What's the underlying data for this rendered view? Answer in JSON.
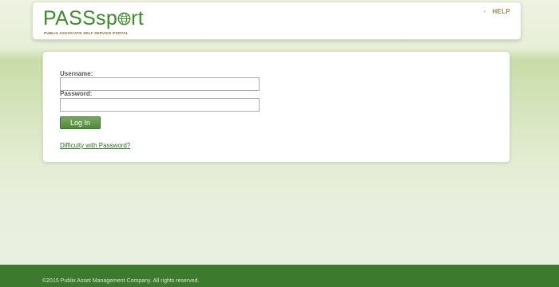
{
  "header": {
    "logo_text": "PASSport",
    "logo_prefix": "PASS",
    "logo_globe_letter": "o",
    "logo_suffix": "rt",
    "logo_tagline": "PUBLIX ASSOCIATE SELF SERVICE PORTAL",
    "bullet": "·",
    "help_label": "HELP"
  },
  "login": {
    "username_label": "Username:",
    "username_value": "",
    "password_label": "Password:",
    "password_value": "",
    "login_button": "Log In",
    "difficulty_link": "Difficulty with Password?"
  },
  "footer": {
    "copyright": "©2015 Publix Asset Management Company. All rights reserved."
  },
  "colors": {
    "brand_green": "#3f8a2c",
    "footer_green": "#3c7a2e",
    "help_tan": "#9a8a55"
  }
}
